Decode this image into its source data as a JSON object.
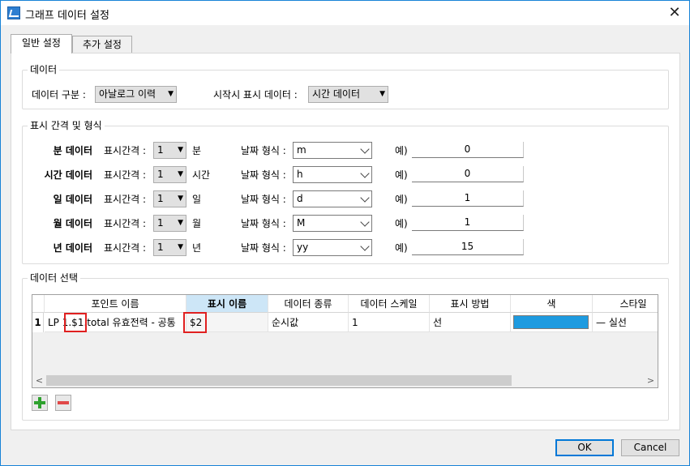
{
  "window": {
    "title": "그래프 데이터 설정"
  },
  "tabs": [
    {
      "label": "일반 설정",
      "active": true
    },
    {
      "label": "추가 설정",
      "active": false
    }
  ],
  "data_group": {
    "title": "데이터",
    "type_label": "데이터 구분 :",
    "type_value": "아날로그 이력",
    "start_label": "시작시 표시 데이터 :",
    "start_value": "시간 데이터"
  },
  "interval_group": {
    "title": "표시 간격 및 형식",
    "interval_label": "표시간격 :",
    "format_label": "날짜 형식 :",
    "example_label": "예)",
    "rows": [
      {
        "name": "분 데이터",
        "interval": "1",
        "unit": "분",
        "format": "m",
        "example": "0"
      },
      {
        "name": "시간 데이터",
        "interval": "1",
        "unit": "시간",
        "format": "h",
        "example": "0"
      },
      {
        "name": "일 데이터",
        "interval": "1",
        "unit": "일",
        "format": "d",
        "example": "1"
      },
      {
        "name": "월 데이터",
        "interval": "1",
        "unit": "월",
        "format": "M",
        "example": "1"
      },
      {
        "name": "년 데이터",
        "interval": "1",
        "unit": "년",
        "format": "yy",
        "example": "15"
      }
    ]
  },
  "select_group": {
    "title": "데이터 선택",
    "columns": [
      "포인트 이름",
      "표시 이름",
      "데이터 종류",
      "데이터 스케일",
      "표시 방법",
      "색",
      "스타일"
    ],
    "rows": [
      {
        "num": "1",
        "point": "LP 1.$1.total 유효전력 - 공통",
        "display": "$2",
        "kind": "순시값",
        "scale": "1",
        "method": "선",
        "style": "— 실선"
      }
    ],
    "row_color": "#1e9be0",
    "selected_header_color": "#cde6f7"
  },
  "buttons": {
    "ok": "OK",
    "cancel": "Cancel"
  },
  "icons": {
    "add": "plus-icon",
    "remove": "minus-icon",
    "close": "close-icon"
  }
}
